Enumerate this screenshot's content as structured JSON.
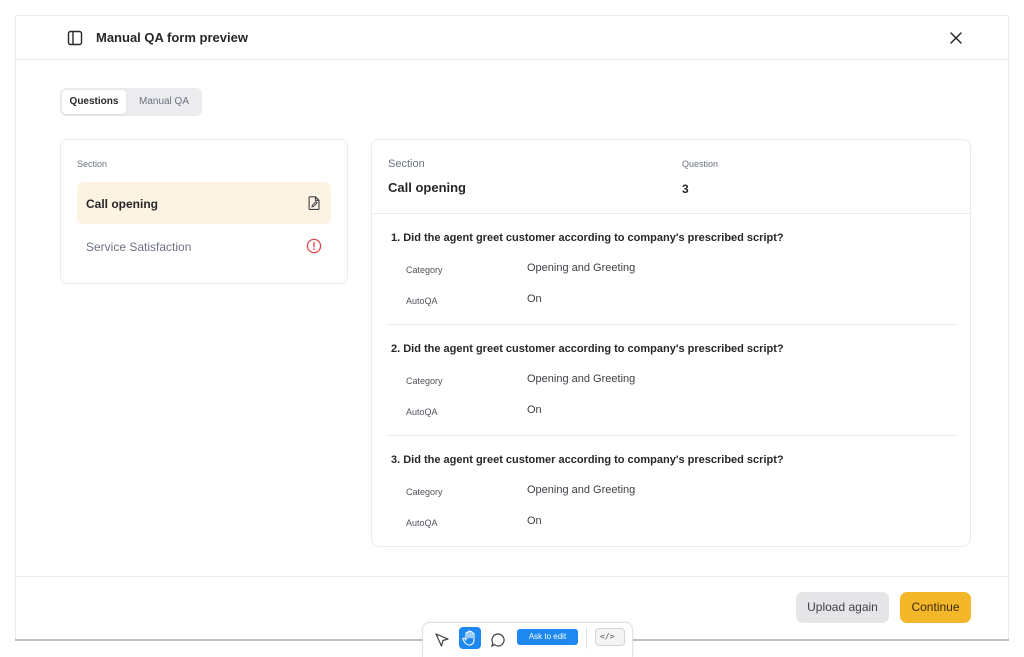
{
  "dialog": {
    "title": "Manual QA form preview",
    "header_icon": "sidebar-panel-icon",
    "close_icon": "close-icon"
  },
  "tabs": [
    {
      "label": "Questions",
      "active": true
    },
    {
      "label": "Manual QA",
      "active": false
    }
  ],
  "sections_panel": {
    "heading": "Section",
    "items": [
      {
        "label": "Call opening",
        "icon": "document-edit-icon",
        "active": true
      },
      {
        "label": "Service Satisfaction",
        "icon": "alert-circle-icon",
        "active": false,
        "icon_color": "#e5484d"
      }
    ]
  },
  "detail": {
    "section_label": "Section",
    "section_value": "Call opening",
    "question_label": "Question",
    "question_value": "3",
    "questions": [
      {
        "title": "1. Did the agent greet customer according to company's prescribed script?",
        "category_label": "Category",
        "category_value": "Opening and Greeting",
        "autoqa_label": "AutoQA",
        "autoqa_value": "On"
      },
      {
        "title": "2. Did the agent greet customer according to company's prescribed script?",
        "category_label": "Category",
        "category_value": "Opening and Greeting",
        "autoqa_label": "AutoQA",
        "autoqa_value": "On"
      },
      {
        "title": "3. Did the agent greet customer according to company's prescribed script?",
        "category_label": "Category",
        "category_value": "Opening and Greeting",
        "autoqa_label": "AutoQA",
        "autoqa_value": "On"
      }
    ]
  },
  "footer": {
    "secondary_label": "Upload again",
    "primary_label": "Continue"
  },
  "toolbar": {
    "ask_label": "Ask to edit",
    "code_label": "</>"
  },
  "colors": {
    "accent": "#f5b72a",
    "active_section_bg": "#fdf3e3",
    "tool_blue": "#1e88f0"
  }
}
